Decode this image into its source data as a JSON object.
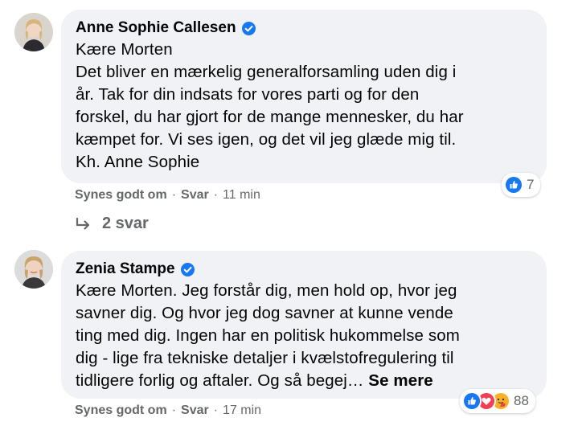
{
  "comments": [
    {
      "author": "Anne Sophie Callesen",
      "verified": true,
      "lines": [
        "Kære Morten",
        "Det bliver en mærkelig generalforsamling uden dig i",
        "år. Tak for din indsats for vores parti og for den",
        "forskel, du har gjort for de mange mennesker, du har",
        "kæmpet for. Vi ses igen, og det vil jeg glæde mig til.",
        "Kh. Anne Sophie"
      ],
      "reactions": {
        "icons": [
          "like-icon"
        ],
        "count": "7"
      },
      "actions": {
        "like": "Synes godt om",
        "reply": "Svar",
        "time": "11 min",
        "separator": "·"
      },
      "replies_label": "2 svar"
    },
    {
      "author": "Zenia Stampe",
      "verified": true,
      "lines": [
        "Kære Morten. Jeg forstår dig, men hold op, hvor jeg",
        "savner dig. Og hvor jeg dog savner at kunne vende",
        "ting med dig. Ingen har en politisk hukommelse som",
        "dig - lige fra tekniske detaljer i kvælstofregulering til"
      ],
      "last_line": "tidligere forlig og aftaler. Og så begej…",
      "see_more": "Se mere",
      "reactions": {
        "icons": [
          "like-icon",
          "love-icon",
          "care-icon"
        ],
        "count": "88"
      },
      "actions": {
        "like": "Synes godt om",
        "reply": "Svar",
        "time": "17 min",
        "separator": "·"
      }
    }
  ],
  "colors": {
    "bubble": "#f0f2f5",
    "verified": "#1877f2",
    "secondary_text": "#65676b",
    "like": "#1877f2",
    "love": "#f33e58",
    "care": "#f7b125"
  }
}
